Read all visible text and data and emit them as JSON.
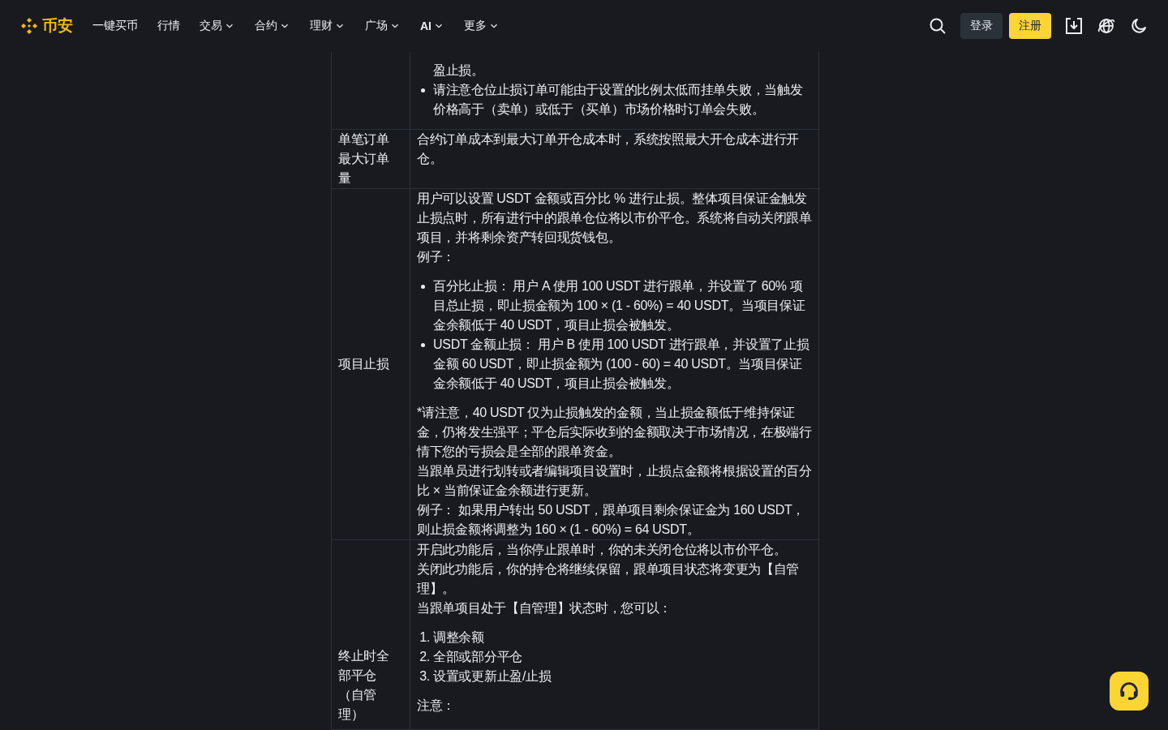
{
  "header": {
    "logo": "币安",
    "nav": [
      {
        "label": "一键买币",
        "dropdown": false
      },
      {
        "label": "行情",
        "dropdown": false
      },
      {
        "label": "交易",
        "dropdown": true
      },
      {
        "label": "合约",
        "dropdown": true
      },
      {
        "label": "理财",
        "dropdown": true
      },
      {
        "label": "广场",
        "dropdown": true
      },
      {
        "label": "AI",
        "dropdown": true
      },
      {
        "label": "更多",
        "dropdown": true
      }
    ],
    "login": "登录",
    "register": "注册"
  },
  "table": {
    "rows": [
      {
        "content": [
          {
            "kind": "bullets",
            "items": [
              {
                "text": "盈止损。",
                "marker": false
              },
              {
                "text": "请注意仓位止损订单可能由于设置的比例太低而挂单失败，当触发价格高于（卖单）或低于（买单）市场价格时订单会失败。",
                "marker": true
              }
            ]
          }
        ]
      },
      {
        "label": "单笔订单最大订单量",
        "content": [
          {
            "kind": "paragraph",
            "text": "合约订单成本到最大订单开仓成本时，系统按照最大开仓成本进行开仓。"
          }
        ]
      },
      {
        "label": "项目止损",
        "content": [
          {
            "kind": "paragraph",
            "text": "用户可以设置 USDT 金额或百分比 % 进行止损。整体项目保证金触发止损点时，所有进行中的跟单仓位将以市价平仓。系统将自动关闭跟单项目，并将剩余资产转回现货钱包。"
          },
          {
            "kind": "paragraph",
            "text": "例子："
          },
          {
            "kind": "bullets",
            "items": [
              {
                "text": "百分比止损： 用户 A 使用 100 USDT 进行跟单，并设置了 60% 项目总止损，即止损金额为 100 × (1 - 60%) = 40 USDT。当项目保证金余额低于 40 USDT，项目止损会被触发。",
                "marker": true
              },
              {
                "text": "USDT 金额止损： 用户 B 使用 100 USDT 进行跟单，并设置了止损金额 60 USDT，即止损金额为 (100 - 60) = 40 USDT。当项目保证金余额低于 40 USDT，项目止损会被触发。",
                "marker": true
              }
            ]
          },
          {
            "kind": "paragraph",
            "text": "*请注意，40 USDT 仅为止损触发的金额，当止损金额低于维持保证金，仍将发生强平；平仓后实际收到的金额取决于市场情况，在极端行情下您的亏损会是全部的跟单资金。"
          },
          {
            "kind": "paragraph",
            "text": "当跟单员进行划转或者编辑项目设置时，止损点金额将根据设置的百分比 × 当前保证金余额进行更新。"
          },
          {
            "kind": "paragraph",
            "text": "例子： 如果用户转出 50 USDT，跟单项目剩余保证金为 160 USDT，则止损金额将调整为 160 × (1 - 60%) = 64 USDT。"
          }
        ]
      },
      {
        "label": "终止时全部平仓（自管理）",
        "content": [
          {
            "kind": "paragraph",
            "text": "开启此功能后，当你停止跟单时，你的未关闭仓位将以市价平仓。"
          },
          {
            "kind": "paragraph",
            "text": "关闭此功能后，你的持仓将继续保留，跟单项目状态将变更为【自管理】。"
          },
          {
            "kind": "paragraph",
            "text": "当跟单项目处于【自管理】状态时，您可以："
          },
          {
            "kind": "numbered",
            "items": [
              {
                "number": "1.",
                "text": "调整余额"
              },
              {
                "number": "2.",
                "text": "全部或部分平仓"
              },
              {
                "number": "3.",
                "text": "设置或更新止盈/止损"
              }
            ]
          },
          {
            "kind": "paragraph",
            "text": "注意："
          }
        ]
      }
    ]
  }
}
